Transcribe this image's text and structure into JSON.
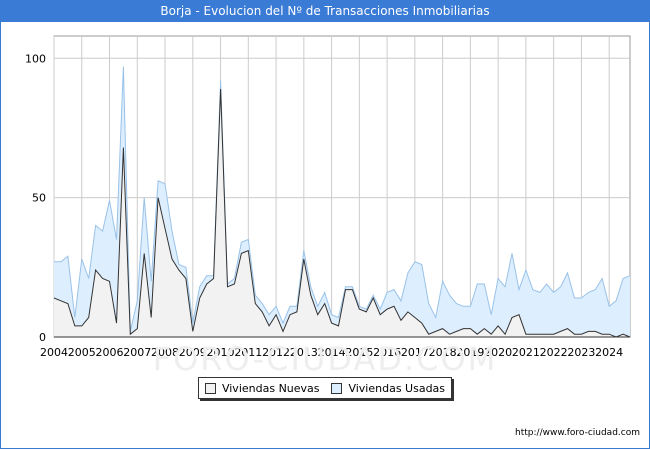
{
  "header": {
    "title": "Borja - Evolucion del Nº de Transacciones Inmobiliarias"
  },
  "watermark": {
    "text": "FORO-CIUDAD.COM"
  },
  "footer": {
    "url": "http://www.foro-ciudad.com"
  },
  "colors": {
    "header_bg": "#3a7bd5",
    "nuevas_fill": "#f2f2f2",
    "nuevas_line": "#333333",
    "usadas_fill": "#ddeeff",
    "usadas_line": "#99c2e8",
    "grid": "#cccccc"
  },
  "chart_data": {
    "type": "area",
    "title": "Borja - Evolucion del Nº de Transacciones Inmobiliarias",
    "xlabel": "",
    "ylabel": "",
    "ylim": [
      0,
      108
    ],
    "xlim": [
      2004,
      2024.75
    ],
    "yticks": [
      0,
      50,
      100
    ],
    "xticks": [
      "2004",
      "2005",
      "2006",
      "2007",
      "2008",
      "2009",
      "2010",
      "2011",
      "2012",
      "2013",
      "2014",
      "2015",
      "2016",
      "2017",
      "2018",
      "2019",
      "2020",
      "2021",
      "2022",
      "2023",
      "2024"
    ],
    "grid": true,
    "legend_position": "bottom",
    "series": [
      {
        "name": "Viviendas Nuevas",
        "x": [
          2004.0,
          2004.25,
          2004.5,
          2004.75,
          2005.0,
          2005.25,
          2005.5,
          2005.75,
          2006.0,
          2006.25,
          2006.5,
          2006.75,
          2007.0,
          2007.25,
          2007.5,
          2007.75,
          2008.0,
          2008.25,
          2008.5,
          2008.75,
          2009.0,
          2009.25,
          2009.5,
          2009.75,
          2010.0,
          2010.25,
          2010.5,
          2010.75,
          2011.0,
          2011.25,
          2011.5,
          2011.75,
          2012.0,
          2012.25,
          2012.5,
          2012.75,
          2013.0,
          2013.25,
          2013.5,
          2013.75,
          2014.0,
          2014.25,
          2014.5,
          2014.75,
          2015.0,
          2015.25,
          2015.5,
          2015.75,
          2016.0,
          2016.25,
          2016.5,
          2016.75,
          2017.0,
          2017.25,
          2017.5,
          2017.75,
          2018.0,
          2018.25,
          2018.5,
          2018.75,
          2019.0,
          2019.25,
          2019.5,
          2019.75,
          2020.0,
          2020.25,
          2020.5,
          2020.75,
          2021.0,
          2021.25,
          2021.5,
          2021.75,
          2022.0,
          2022.25,
          2022.5,
          2022.75,
          2023.0,
          2023.25,
          2023.5,
          2023.75,
          2024.0,
          2024.25,
          2024.5,
          2024.75
        ],
        "values": [
          14,
          13,
          12,
          4,
          4,
          7,
          24,
          21,
          20,
          5,
          68,
          1,
          3,
          30,
          7,
          50,
          39,
          28,
          24,
          21,
          2,
          14,
          19,
          21,
          89,
          18,
          19,
          30,
          31,
          12,
          9,
          4,
          8,
          2,
          8,
          9,
          28,
          15,
          8,
          12,
          5,
          4,
          17,
          17,
          10,
          9,
          14,
          8,
          10,
          11,
          6,
          9,
          7,
          5,
          1,
          2,
          3,
          1,
          2,
          3,
          3,
          1,
          3,
          1,
          4,
          1,
          7,
          8,
          1,
          1,
          1,
          1,
          1,
          2,
          3,
          1,
          1,
          2,
          2,
          1,
          1,
          0,
          1,
          0
        ]
      },
      {
        "name": "Viviendas Usadas",
        "x": [
          2004.0,
          2004.25,
          2004.5,
          2004.75,
          2005.0,
          2005.25,
          2005.5,
          2005.75,
          2006.0,
          2006.25,
          2006.5,
          2006.75,
          2007.0,
          2007.25,
          2007.5,
          2007.75,
          2008.0,
          2008.25,
          2008.5,
          2008.75,
          2009.0,
          2009.25,
          2009.5,
          2009.75,
          2010.0,
          2010.25,
          2010.5,
          2010.75,
          2011.0,
          2011.25,
          2011.5,
          2011.75,
          2012.0,
          2012.25,
          2012.5,
          2012.75,
          2013.0,
          2013.25,
          2013.5,
          2013.75,
          2014.0,
          2014.25,
          2014.5,
          2014.75,
          2015.0,
          2015.25,
          2015.5,
          2015.75,
          2016.0,
          2016.25,
          2016.5,
          2016.75,
          2017.0,
          2017.25,
          2017.5,
          2017.75,
          2018.0,
          2018.25,
          2018.5,
          2018.75,
          2019.0,
          2019.25,
          2019.5,
          2019.75,
          2020.0,
          2020.25,
          2020.5,
          2020.75,
          2021.0,
          2021.25,
          2021.5,
          2021.75,
          2022.0,
          2022.25,
          2022.5,
          2022.75,
          2023.0,
          2023.25,
          2023.5,
          2023.75,
          2024.0,
          2024.25,
          2024.5,
          2024.75
        ],
        "values": [
          13,
          14,
          17,
          3,
          24,
          14,
          16,
          17,
          29,
          30,
          29,
          1,
          10,
          20,
          13,
          6,
          16,
          10,
          2,
          4,
          3,
          4,
          3,
          1,
          3,
          1,
          2,
          4,
          4,
          3,
          3,
          4,
          3,
          3,
          3,
          2,
          3,
          3,
          3,
          4,
          3,
          3,
          1,
          1,
          1,
          1,
          1,
          2,
          6,
          6,
          7,
          14,
          20,
          21,
          11,
          5,
          17,
          14,
          10,
          8,
          8,
          18,
          16,
          7,
          17,
          17,
          23,
          9,
          23,
          16,
          15,
          18,
          15,
          16,
          20,
          13,
          13,
          14,
          15,
          20,
          10,
          13,
          20,
          22
        ]
      }
    ]
  }
}
